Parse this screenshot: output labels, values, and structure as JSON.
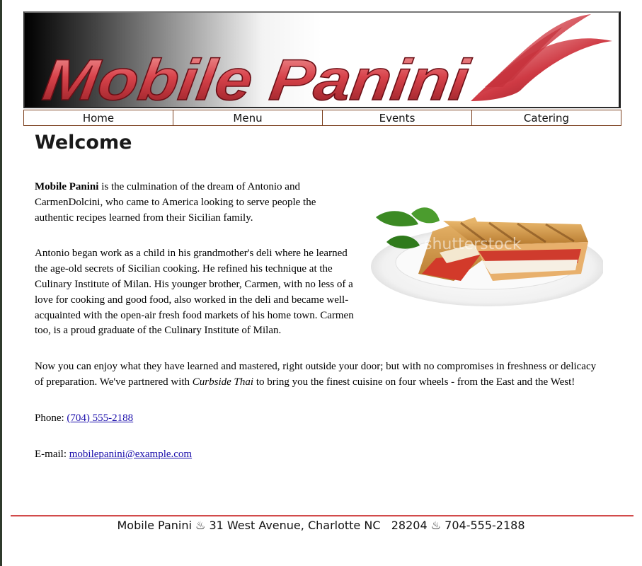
{
  "banner": {
    "logo_text": "Mobile Panini"
  },
  "nav": {
    "items": [
      "Home",
      "Menu",
      "Events",
      "Catering"
    ]
  },
  "page": {
    "heading": "Welcome"
  },
  "content": {
    "p1_brand": "Mobile Panini",
    "p1_text": " is the culmination of the dream of Antonio and CarmenDolcini, who came to America looking to serve people the authentic recipes learned from their Sicilian family.",
    "p2_text": "Antonio began work as a child in his grandmother's deli where he learned the age-old secrets of Sicilian cooking. He refined his technique at the Culinary Institute of Milan. His younger brother, Carmen, with no less of a love for cooking and good food, also worked in the deli and became well-acquainted with the open-air fresh food markets of his home town. Carmen too, is a proud graduate of the Culinary Institute of Milan.",
    "p3_before": "Now you can enjoy what they have learned and mastered, right outside your door; but with no compromises in freshness or delicacy of preparation. We've partnered with ",
    "p3_partner": "Curbside Thai",
    "p3_after": " to bring you the finest cuisine on four wheels - from the East and the West!",
    "phone_label": "Phone: ",
    "phone_link": "(704) 555-2188",
    "email_label": "E-mail: ",
    "email_link": "mobilepanini@example.com"
  },
  "photo": {
    "watermark": "shutterstock",
    "icon": "panini-sandwich-photo"
  },
  "footer": {
    "text": "Mobile Panini ♨ 31 West Avenue, Charlotte NC   28204 ♨ 704-555-2188"
  },
  "colors": {
    "accent": "#d24b4b",
    "nav_border": "#7a3e1c",
    "link": "#1a0dab"
  }
}
